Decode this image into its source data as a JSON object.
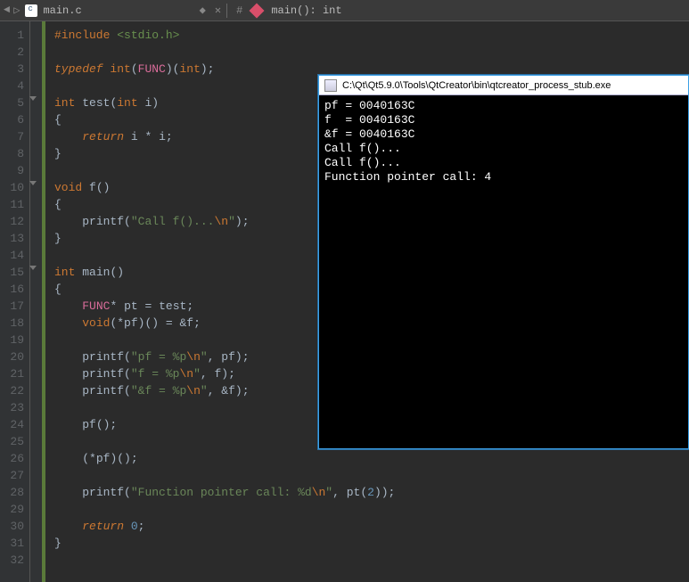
{
  "topbar": {
    "filename": "main.c",
    "symbol": "main(): int"
  },
  "code": {
    "lines": [
      {
        "n": 1,
        "html": "<span class='kwn'>#include</span> <span class='inc'>&lt;stdio.h&gt;</span>"
      },
      {
        "n": 2,
        "html": ""
      },
      {
        "n": 3,
        "html": "<span class='kw'>typedef</span> <span class='kwn'>int</span><span class='punc'>(</span><span class='typedef'>FUNC</span><span class='punc'>)(</span><span class='kwn'>int</span><span class='punc'>);</span>"
      },
      {
        "n": 4,
        "html": ""
      },
      {
        "n": 5,
        "fold": true,
        "html": "<span class='kwn'>int</span> <span class='ident'>test</span><span class='punc'>(</span><span class='kwn'>int</span> <span class='ident'>i</span><span class='punc'>)</span>"
      },
      {
        "n": 6,
        "html": "<span class='punc'>{</span>"
      },
      {
        "n": 7,
        "html": "    <span class='kw'>return</span> <span class='ident'>i</span> <span class='punc'>*</span> <span class='ident'>i</span><span class='punc'>;</span>"
      },
      {
        "n": 8,
        "html": "<span class='punc'>}</span>"
      },
      {
        "n": 9,
        "html": ""
      },
      {
        "n": 10,
        "fold": true,
        "html": "<span class='kwn'>void</span> <span class='ident'>f</span><span class='punc'>()</span>"
      },
      {
        "n": 11,
        "html": "<span class='punc'>{</span>"
      },
      {
        "n": 12,
        "html": "    <span class='ident'>printf</span><span class='punc'>(</span><span class='str'>\"Call f()...</span><span class='esc'>\\n</span><span class='str'>\"</span><span class='punc'>);</span>"
      },
      {
        "n": 13,
        "html": "<span class='punc'>}</span>"
      },
      {
        "n": 14,
        "html": ""
      },
      {
        "n": 15,
        "fold": true,
        "html": "<span class='kwn'>int</span> <span class='ident'>main</span><span class='punc'>()</span>"
      },
      {
        "n": 16,
        "html": "<span class='punc'>{</span>"
      },
      {
        "n": 17,
        "html": "    <span class='typedef'>FUNC</span><span class='punc'>*</span> <span class='ident'>pt</span> <span class='punc'>=</span> <span class='ident'>test</span><span class='punc'>;</span>"
      },
      {
        "n": 18,
        "html": "    <span class='kwn'>void</span><span class='punc'>(*</span><span class='ident'>pf</span><span class='punc'>)() = &amp;</span><span class='ident'>f</span><span class='punc'>;</span>"
      },
      {
        "n": 19,
        "html": ""
      },
      {
        "n": 20,
        "html": "    <span class='ident'>printf</span><span class='punc'>(</span><span class='str'>\"pf = %p</span><span class='esc'>\\n</span><span class='str'>\"</span><span class='punc'>, </span><span class='ident'>pf</span><span class='punc'>);</span>"
      },
      {
        "n": 21,
        "html": "    <span class='ident'>printf</span><span class='punc'>(</span><span class='str'>\"f = %p</span><span class='esc'>\\n</span><span class='str'>\"</span><span class='punc'>, </span><span class='ident'>f</span><span class='punc'>);</span>"
      },
      {
        "n": 22,
        "html": "    <span class='ident'>printf</span><span class='punc'>(</span><span class='str'>\"&amp;f = %p</span><span class='esc'>\\n</span><span class='str'>\"</span><span class='punc'>, &amp;</span><span class='ident'>f</span><span class='punc'>);</span>"
      },
      {
        "n": 23,
        "html": ""
      },
      {
        "n": 24,
        "html": "    <span class='ident'>pf</span><span class='punc'>();</span>"
      },
      {
        "n": 25,
        "html": ""
      },
      {
        "n": 26,
        "html": "    <span class='punc'>(*</span><span class='ident'>pf</span><span class='punc'>)();</span>"
      },
      {
        "n": 27,
        "html": ""
      },
      {
        "n": 28,
        "html": "    <span class='ident'>printf</span><span class='punc'>(</span><span class='str'>\"Function pointer call: %d</span><span class='esc'>\\n</span><span class='str'>\"</span><span class='punc'>, </span><span class='ident'>pt</span><span class='punc'>(</span><span class='num'>2</span><span class='punc'>));</span>"
      },
      {
        "n": 29,
        "html": ""
      },
      {
        "n": 30,
        "html": "    <span class='kw'>return</span> <span class='num'>0</span><span class='punc'>;</span>"
      },
      {
        "n": 31,
        "html": "<span class='punc'>}</span>"
      },
      {
        "n": 32,
        "html": ""
      }
    ]
  },
  "console": {
    "title": "C:\\Qt\\Qt5.9.0\\Tools\\QtCreator\\bin\\qtcreator_process_stub.exe",
    "output": "pf = 0040163C\nf  = 0040163C\n&f = 0040163C\nCall f()...\nCall f()...\nFunction pointer call: 4"
  }
}
